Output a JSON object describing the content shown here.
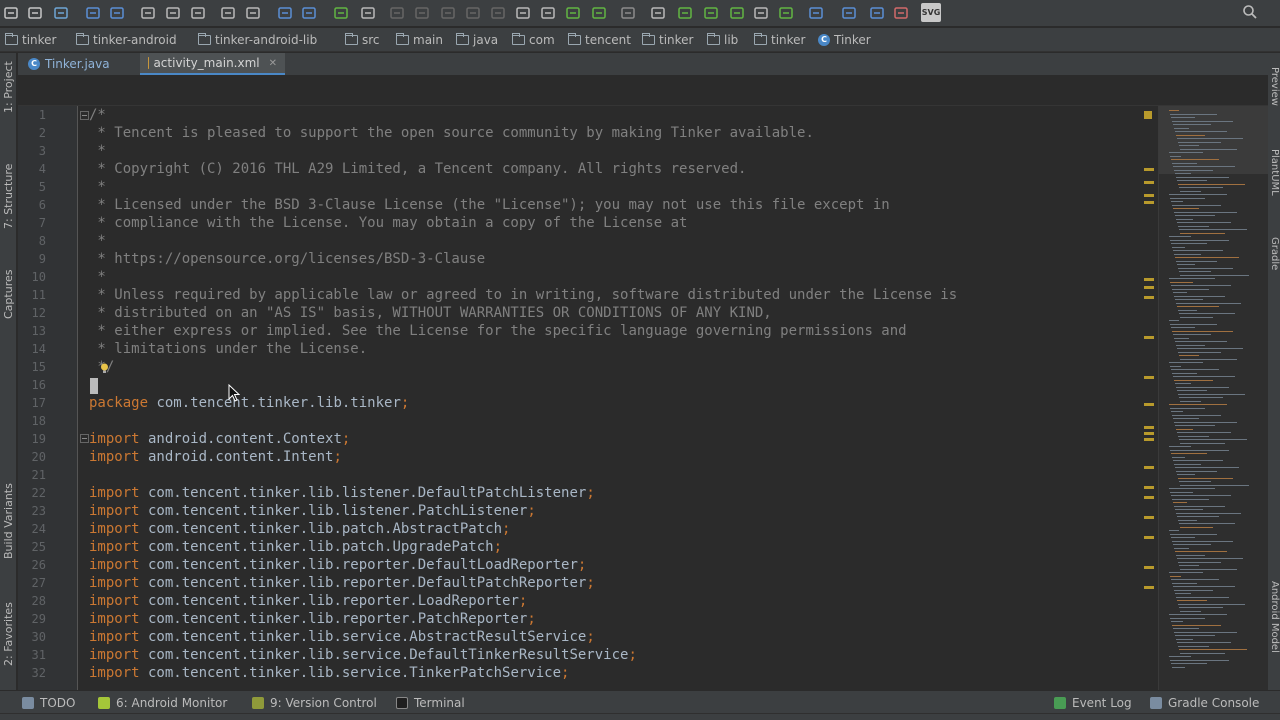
{
  "toolbar": {
    "icons": [
      "open-icon",
      "save-icon",
      "sync-icon",
      "undo-icon",
      "redo-icon",
      "cut-icon",
      "copy-icon",
      "paste-icon",
      "find-icon",
      "replace-icon",
      "back-icon",
      "forward-icon",
      "build-icon",
      "run-config-icon",
      "run-icon",
      "debug-icon",
      "profile-icon",
      "attach-icon",
      "stop-icon",
      "gradle-sync-icon",
      "avd-icon",
      "sdk-icon",
      "structure-icon",
      "help-icon"
    ],
    "svg_label": "SVG"
  },
  "breadcrumb": [
    {
      "label": "tinker",
      "icon": "folder-icon"
    },
    {
      "label": "tinker-android",
      "icon": "folder-icon"
    },
    {
      "label": "tinker-android-lib",
      "icon": "folder-icon"
    },
    {
      "label": "src",
      "icon": "folder-icon"
    },
    {
      "label": "main",
      "icon": "folder-icon"
    },
    {
      "label": "java",
      "icon": "folder-icon"
    },
    {
      "label": "com",
      "icon": "folder-icon"
    },
    {
      "label": "tencent",
      "icon": "folder-icon"
    },
    {
      "label": "tinker",
      "icon": "folder-icon"
    },
    {
      "label": "lib",
      "icon": "folder-icon"
    },
    {
      "label": "tinker",
      "icon": "folder-icon"
    },
    {
      "label": "Tinker",
      "icon": "class-icon"
    }
  ],
  "tabs": [
    {
      "label": "Tinker.java",
      "active": false
    },
    {
      "label": "activity_main.xml",
      "active": true
    }
  ],
  "left_tools": [
    "1: Project",
    "7: Structure",
    "Captures",
    "Build Variants",
    "2: Favorites"
  ],
  "right_tools": [
    "Preview",
    "PlantUML",
    "Gradle",
    "Android Model"
  ],
  "editor": {
    "lines": [
      {
        "n": "1",
        "t": "/*",
        "k": "cm"
      },
      {
        "n": "2",
        "t": " * Tencent is pleased to support the open source community by making Tinker available.",
        "k": "cm"
      },
      {
        "n": "3",
        "t": " *",
        "k": "cm"
      },
      {
        "n": "4",
        "t": " * Copyright (C) 2016 THL A29 Limited, a Tencent company. All rights reserved.",
        "k": "cm"
      },
      {
        "n": "5",
        "t": " *",
        "k": "cm"
      },
      {
        "n": "6",
        "t": " * Licensed under the BSD 3-Clause License (the \"License\"); you may not use this file except in",
        "k": "cm"
      },
      {
        "n": "7",
        "t": " * compliance with the License. You may obtain a copy of the License at",
        "k": "cm"
      },
      {
        "n": "8",
        "t": " *",
        "k": "cm"
      },
      {
        "n": "9",
        "t": " * https://opensource.org/licenses/BSD-3-Clause",
        "k": "cm"
      },
      {
        "n": "10",
        "t": " *",
        "k": "cm"
      },
      {
        "n": "11",
        "t": " * Unless required by applicable law or agreed to in writing, software distributed under the License is",
        "k": "cm"
      },
      {
        "n": "12",
        "t": " * distributed on an \"AS IS\" basis, WITHOUT WARRANTIES OR CONDITIONS OF ANY KIND,",
        "k": "cm"
      },
      {
        "n": "13",
        "t": " * either express or implied. See the License for the specific language governing permissions and",
        "k": "cm"
      },
      {
        "n": "14",
        "t": " * limitations under the License.",
        "k": "cm"
      },
      {
        "n": "15",
        "t": " */",
        "k": "cm"
      },
      {
        "n": "16",
        "t": "",
        "k": "plain"
      },
      {
        "n": "17",
        "kw": "package",
        "t": " com.tencent.tinker.lib.tinker",
        "semi": ";",
        "k": "code"
      },
      {
        "n": "18",
        "t": "",
        "k": "plain"
      },
      {
        "n": "19",
        "kw": "import",
        "t": " android.content.Context",
        "semi": ";",
        "k": "code"
      },
      {
        "n": "20",
        "kw": "import",
        "t": " android.content.Intent",
        "semi": ";",
        "k": "code"
      },
      {
        "n": "21",
        "t": "",
        "k": "plain"
      },
      {
        "n": "22",
        "kw": "import",
        "t": " com.tencent.tinker.lib.listener.DefaultPatchListener",
        "semi": ";",
        "k": "code"
      },
      {
        "n": "23",
        "kw": "import",
        "t": " com.tencent.tinker.lib.listener.PatchListener",
        "semi": ";",
        "k": "code"
      },
      {
        "n": "24",
        "kw": "import",
        "t": " com.tencent.tinker.lib.patch.AbstractPatch",
        "semi": ";",
        "k": "code"
      },
      {
        "n": "25",
        "kw": "import",
        "t": " com.tencent.tinker.lib.patch.UpgradePatch",
        "semi": ";",
        "k": "code"
      },
      {
        "n": "26",
        "kw": "import",
        "t": " com.tencent.tinker.lib.reporter.DefaultLoadReporter",
        "semi": ";",
        "k": "code"
      },
      {
        "n": "27",
        "kw": "import",
        "t": " com.tencent.tinker.lib.reporter.DefaultPatchReporter",
        "semi": ";",
        "k": "code"
      },
      {
        "n": "28",
        "kw": "import",
        "t": " com.tencent.tinker.lib.reporter.LoadReporter",
        "semi": ";",
        "k": "code"
      },
      {
        "n": "29",
        "kw": "import",
        "t": " com.tencent.tinker.lib.reporter.PatchReporter",
        "semi": ";",
        "k": "code"
      },
      {
        "n": "30",
        "kw": "import",
        "t": " com.tencent.tinker.lib.service.AbstractResultService",
        "semi": ";",
        "k": "code"
      },
      {
        "n": "31",
        "kw": "import",
        "t": " com.tencent.tinker.lib.service.DefaultTinkerResultService",
        "semi": ";",
        "k": "code"
      },
      {
        "n": "32",
        "kw": "import",
        "t": " com.tencent.tinker.lib.service.TinkerPatchService",
        "semi": ";",
        "k": "code"
      }
    ]
  },
  "bottom_tools": [
    {
      "label": "TODO",
      "icon": "todo-icon"
    },
    {
      "label": "6: Android Monitor",
      "icon": "android-icon"
    },
    {
      "label": "9: Version Control",
      "icon": "vcs-icon"
    },
    {
      "label": "Terminal",
      "icon": "terminal-icon"
    },
    {
      "label": "Event Log",
      "icon": "event-log-icon"
    },
    {
      "label": "Gradle Console",
      "icon": "gradle-console-icon"
    }
  ],
  "colors": {
    "background": "#2b2b2b",
    "keyword": "#cc7832",
    "comment": "#808080",
    "text": "#a9b7c6",
    "line_number": "#606366",
    "marker": "#b89a2c"
  }
}
